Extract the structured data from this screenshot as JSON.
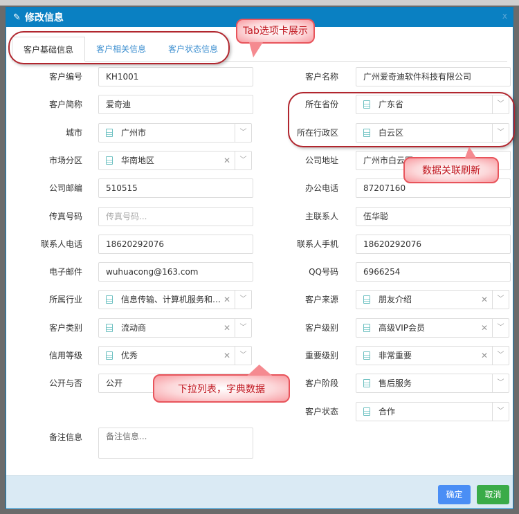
{
  "dialog": {
    "title": "修改信息",
    "close": "x"
  },
  "tabs": [
    {
      "label": "客户基础信息",
      "active": true
    },
    {
      "label": "客户相关信息"
    },
    {
      "label": "客户状态信息"
    }
  ],
  "left": [
    {
      "label": "客户编号",
      "type": "text",
      "value": "KH1001"
    },
    {
      "label": "客户简称",
      "type": "text",
      "value": "爱奇迪"
    },
    {
      "label": "城市",
      "type": "select",
      "value": "广州市",
      "clear": false
    },
    {
      "label": "市场分区",
      "type": "select",
      "value": "华南地区",
      "clear": true
    },
    {
      "label": "公司邮编",
      "type": "text",
      "value": "510515"
    },
    {
      "label": "传真号码",
      "type": "text",
      "value": "",
      "placeholder": "传真号码..."
    },
    {
      "label": "联系人电话",
      "type": "text",
      "value": "18620292076"
    },
    {
      "label": "电子邮件",
      "type": "text",
      "value": "wuhuacong@163.com"
    },
    {
      "label": "所属行业",
      "type": "select",
      "value": "信息传输、计算机服务和软件业",
      "clear": true
    },
    {
      "label": "客户类别",
      "type": "select",
      "value": "流动商",
      "clear": true
    },
    {
      "label": "信用等级",
      "type": "select",
      "value": "优秀",
      "clear": true
    },
    {
      "label": "公开与否",
      "type": "text",
      "value": "公开"
    }
  ],
  "right": [
    {
      "label": "客户名称",
      "type": "text",
      "value": "广州爱奇迪软件科技有限公司"
    },
    {
      "label": "所在省份",
      "type": "select",
      "value": "广东省",
      "clear": false
    },
    {
      "label": "所在行政区",
      "type": "select",
      "value": "白云区",
      "clear": false
    },
    {
      "label": "公司地址",
      "type": "text",
      "value": "广州市白云区"
    },
    {
      "label": "办公电话",
      "type": "text",
      "value": "87207160"
    },
    {
      "label": "主联系人",
      "type": "text",
      "value": "伍华聪"
    },
    {
      "label": "联系人手机",
      "type": "text",
      "value": "18620292076"
    },
    {
      "label": "QQ号码",
      "type": "text",
      "value": "6966254"
    },
    {
      "label": "客户来源",
      "type": "select",
      "value": "朋友介绍",
      "clear": true
    },
    {
      "label": "客户级别",
      "type": "select",
      "value": "高级VIP会员",
      "clear": true
    },
    {
      "label": "重要级别",
      "type": "select",
      "value": "非常重要",
      "clear": true
    },
    {
      "label": "客户阶段",
      "type": "select",
      "value": "售后服务",
      "clear": false
    },
    {
      "label": "客户状态",
      "type": "select",
      "value": "合作",
      "clear": false
    }
  ],
  "remark": {
    "label": "备注信息",
    "placeholder": "备注信息..."
  },
  "footer": {
    "ok": "确定",
    "cancel": "取消"
  },
  "annotations": {
    "tab": "Tab选项卡展示",
    "linked": "数据关联刷新",
    "dict": "下拉列表，字典数据"
  },
  "colors": {
    "header": "#0a80c2",
    "ok": "#4a8ef5",
    "cancel": "#3aab48",
    "callout_text": "#c0141d"
  }
}
